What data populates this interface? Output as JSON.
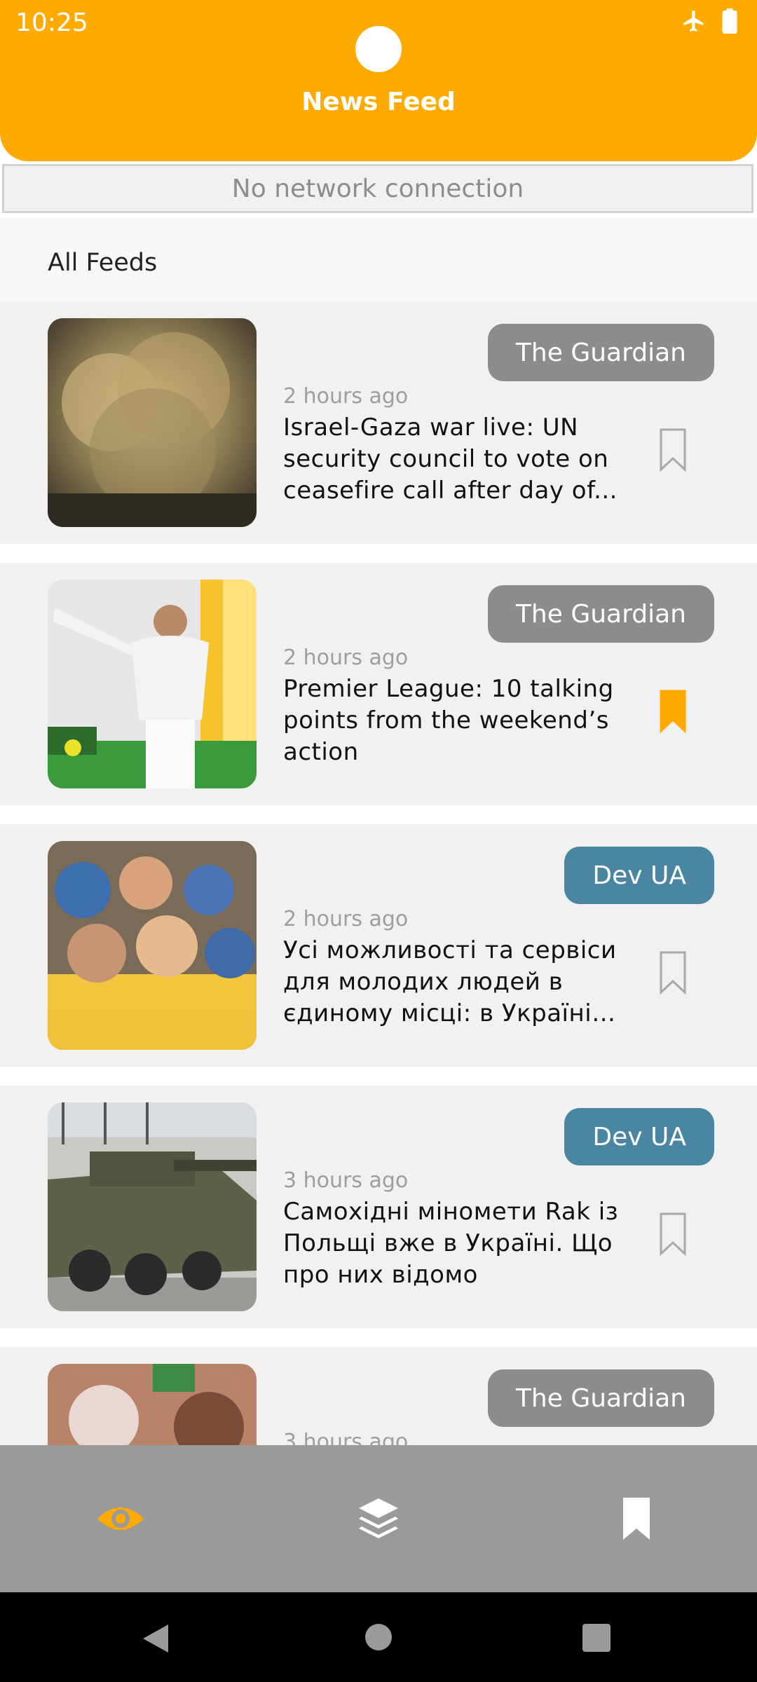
{
  "status_bar": {
    "time": "10:25"
  },
  "header": {
    "title": "News Feed"
  },
  "network_banner": "No network connection",
  "section": {
    "title": "All Feeds"
  },
  "colors": {
    "accent": "#FFAA00",
    "guardian": "#8C8C8C",
    "devua": "#4A86A2"
  },
  "feeds": [
    {
      "source": "The Guardian",
      "time": "2 hours ago",
      "headline": "Israel-Gaza war live: UN security council to vote on ceasefire call after day of...",
      "bookmarked": false
    },
    {
      "source": "The Guardian",
      "time": "2 hours ago",
      "headline": "Premier League: 10 talking points from the weekend’s action",
      "bookmarked": true
    },
    {
      "source": "Dev UA",
      "time": "2 hours ago",
      "headline": "Усі можливості та сервіси для молодих людей в єдиному місці: в Україні с...",
      "bookmarked": false
    },
    {
      "source": "Dev UA",
      "time": "3 hours ago",
      "headline": "Самохідні міномети Rak із Польщі вже в Україні. Що про них відомо",
      "bookmarked": false
    },
    {
      "source": "The Guardian",
      "time": "3 hours ago",
      "headline": "",
      "bookmarked": false
    }
  ],
  "bottom_nav": [
    {
      "icon": "eye-icon",
      "active": true
    },
    {
      "icon": "layers-icon",
      "active": false
    },
    {
      "icon": "bookmark-icon",
      "active": false
    }
  ]
}
